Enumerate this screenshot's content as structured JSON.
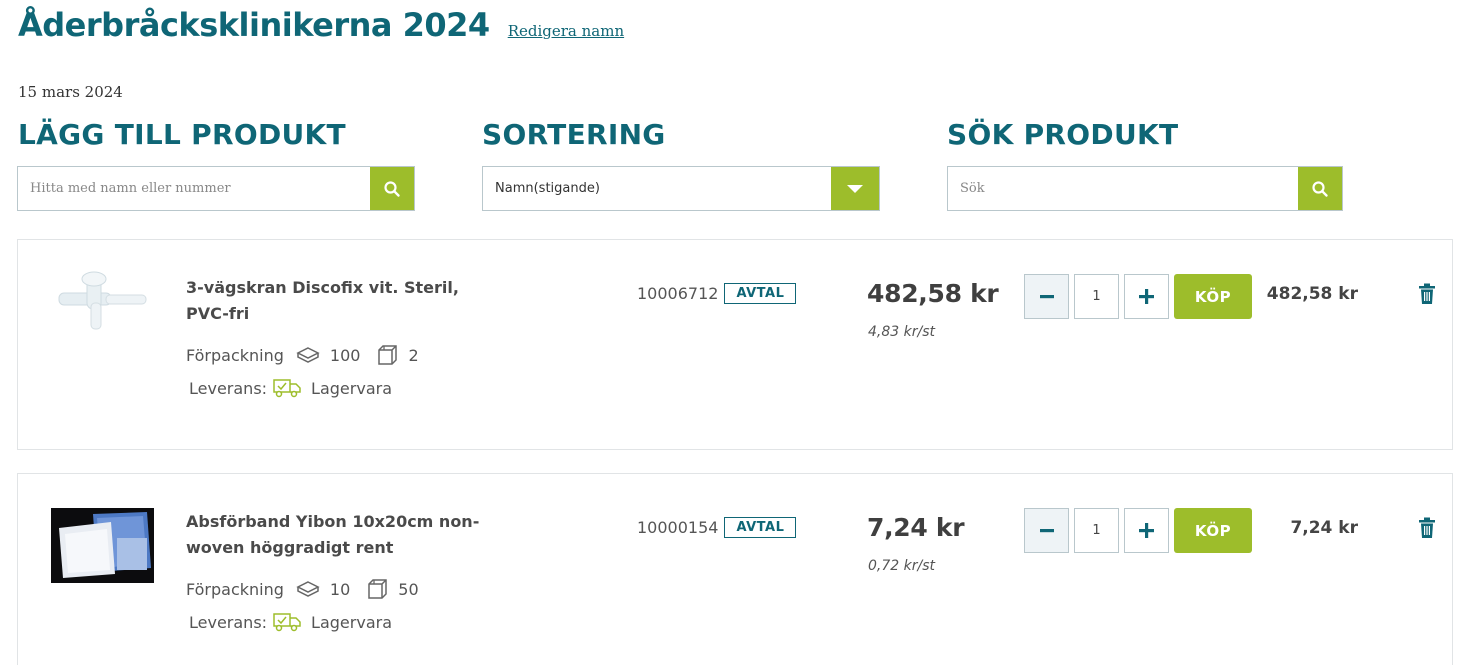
{
  "header": {
    "title": "Åderbråcksklinikerna 2024",
    "edit_link": "Redigera namn",
    "date": "15 mars 2024"
  },
  "sections": {
    "add_product": {
      "heading": "LÄGG TILL PRODUKT",
      "placeholder": "Hitta med namn eller nummer",
      "button_icon": "search-icon"
    },
    "sorting": {
      "heading": "SORTERING",
      "selected": "Namn(stigande)",
      "button_icon": "chevron-down-icon"
    },
    "search": {
      "heading": "SÖK PRODUKT",
      "placeholder": "Sök",
      "button_icon": "search-icon"
    }
  },
  "colors": {
    "brand": "#0f6676",
    "accent": "#9dbd2b"
  },
  "products": [
    {
      "name": "3-vägskran Discofix vit. Steril, PVC-fri",
      "packaging_label": "Förpackning",
      "pack_qty": "100",
      "box_qty": "2",
      "delivery_label": "Leverans:",
      "delivery_status": "Lagervara",
      "article_number": "10006712",
      "badge": "AVTAL",
      "price": "482,58 kr",
      "unit_price": "4,83 kr/st",
      "quantity": "1",
      "buy_label": "KÖP",
      "line_total": "482,58  kr"
    },
    {
      "name": "Absförband Yibon 10x20cm non-woven höggradigt rent",
      "packaging_label": "Förpackning",
      "pack_qty": "10",
      "box_qty": "50",
      "delivery_label": "Leverans:",
      "delivery_status": "Lagervara",
      "article_number": "10000154",
      "badge": "AVTAL",
      "price": "7,24 kr",
      "unit_price": "0,72 kr/st",
      "quantity": "1",
      "buy_label": "KÖP",
      "line_total": "7,24  kr"
    }
  ]
}
